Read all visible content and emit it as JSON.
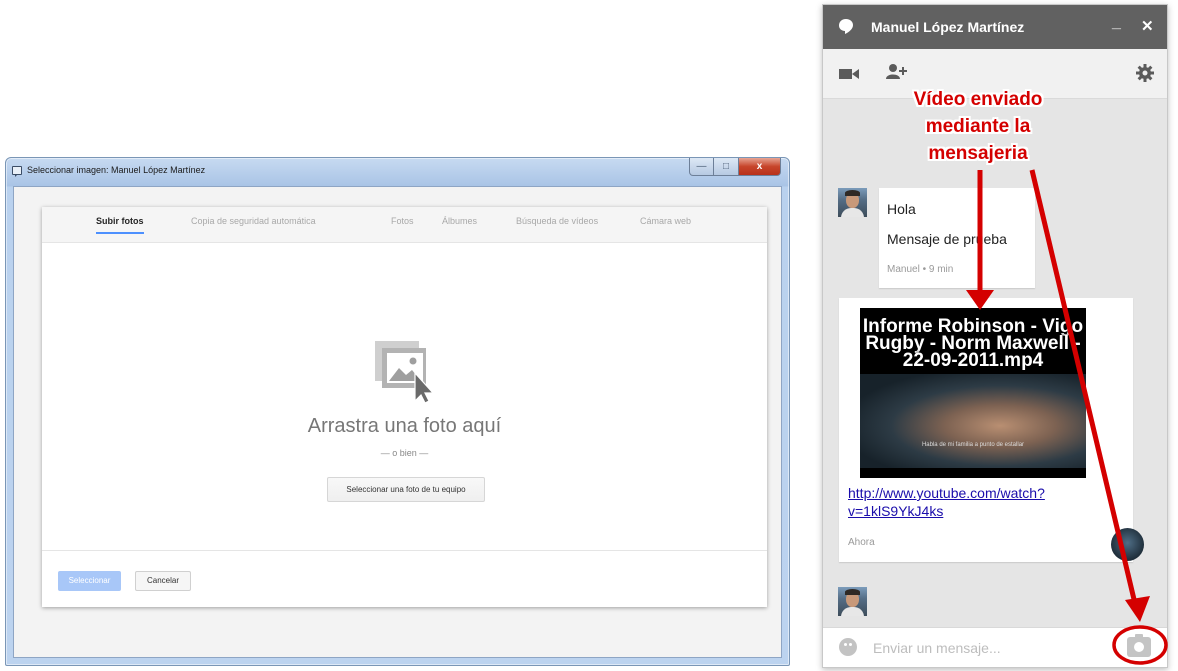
{
  "dialog": {
    "window_title": "Seleccionar imagen: Manuel López Martínez",
    "controls": {
      "minimize": "—",
      "maximize": "□",
      "close": "x"
    },
    "tabs": [
      {
        "label": "Subir fotos",
        "active": true
      },
      {
        "label": "Copia de seguridad automática",
        "active": false
      },
      {
        "label": "Fotos",
        "active": false
      },
      {
        "label": "Álbumes",
        "active": false
      },
      {
        "label": "Búsqueda de vídeos",
        "active": false
      },
      {
        "label": "Cámara web",
        "active": false
      }
    ],
    "drop_title": "Arrastra una foto aquí",
    "or_text": "— o bien —",
    "pick_button": "Seleccionar una foto de tu equipo",
    "select_button": "Seleccionar",
    "cancel_button": "Cancelar",
    "accent_color": "#4d90fe"
  },
  "chat": {
    "contact_name": "Manuel López Martínez",
    "header_buttons": {
      "minimize": "_",
      "close": "✕"
    },
    "toolbar_icons": [
      "video-call-icon",
      "add-person-icon",
      "settings-icon"
    ],
    "messages": [
      {
        "lines": [
          "Hola",
          "Mensaje de prueba"
        ],
        "meta": "Manuel • 9 min"
      },
      {
        "video_title": "Informe Robinson - Vigo Rugby - Norm Maxwell - 22-09-2011.mp4",
        "video_subtitle": "Habla de mi familia a punto de estallar",
        "link": "http://www.youtube.com/watch?v=1klS9YkJ4ks",
        "time": "Ahora"
      }
    ],
    "input_placeholder": "Enviar un mensaje...",
    "header_color": "#616161"
  },
  "annotation": {
    "text": "Vídeo enviado mediante la mensajeria",
    "color": "#d40000"
  }
}
